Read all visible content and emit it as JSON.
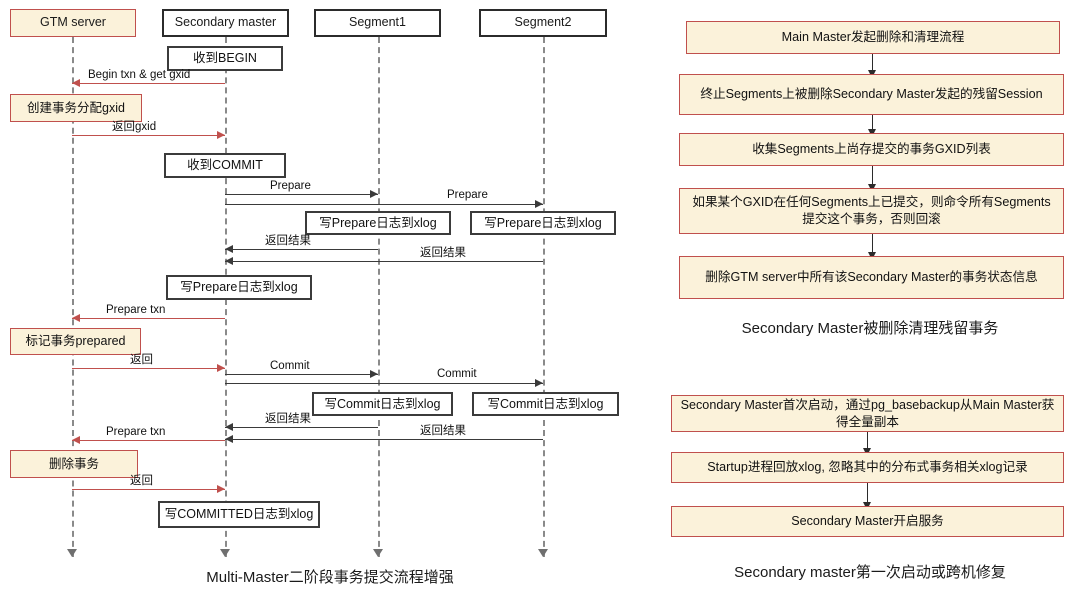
{
  "diagram": {
    "left": {
      "caption": "Multi-Master二阶段事务提交流程增强",
      "lifelines": [
        {
          "label": "GTM server",
          "accent": true
        },
        {
          "label": "Secondary master",
          "accent": false
        },
        {
          "label": "Segment1",
          "accent": false
        },
        {
          "label": "Segment2",
          "accent": false
        }
      ],
      "activities": [
        {
          "label": "收到BEGIN"
        },
        {
          "label": "收到COMMIT"
        },
        {
          "label": "写Prepare日志到xlog"
        },
        {
          "label": "写Prepare日志到xlog"
        },
        {
          "label": "写Prepare日志到xlog"
        },
        {
          "label": "写Commit日志到xlog"
        },
        {
          "label": "写Commit日志到xlog"
        },
        {
          "label": "写COMMITTED日志到xlog"
        }
      ],
      "gtm_states": [
        {
          "label": "创建事务分配gxid"
        },
        {
          "label": "标记事务prepared"
        },
        {
          "label": "删除事务"
        }
      ],
      "messages": [
        {
          "label": "Begin txn & get gxid",
          "color": "red",
          "dir": "left"
        },
        {
          "label": "返回gxid",
          "color": "red",
          "dir": "right"
        },
        {
          "label": "Prepare",
          "color": "black",
          "dir": "right"
        },
        {
          "label": "Prepare",
          "color": "black",
          "dir": "right"
        },
        {
          "label": "返回结果",
          "color": "black",
          "dir": "left"
        },
        {
          "label": "返回结果",
          "color": "black",
          "dir": "left"
        },
        {
          "label": "Prepare txn",
          "color": "red",
          "dir": "left"
        },
        {
          "label": "返回",
          "color": "red",
          "dir": "right"
        },
        {
          "label": "Commit",
          "color": "black",
          "dir": "right"
        },
        {
          "label": "Commit",
          "color": "black",
          "dir": "right"
        },
        {
          "label": "返回结果",
          "color": "black",
          "dir": "left"
        },
        {
          "label": "返回结果",
          "color": "black",
          "dir": "left"
        },
        {
          "label": "Prepare txn",
          "color": "red",
          "dir": "left"
        },
        {
          "label": "返回",
          "color": "red",
          "dir": "right"
        }
      ]
    },
    "right_top": {
      "caption": "Secondary  Master被删除清理残留事务",
      "steps": [
        {
          "label": "Main Master发起删除和清理流程"
        },
        {
          "label": "终止Segments上被删除Secondary Master发起的残留Session"
        },
        {
          "label": "收集Segments上尚存提交的事务GXID列表"
        },
        {
          "label": "如果某个GXID在任何Segments上已提交，则命令所有Segments提交这个事务，否则回滚"
        },
        {
          "label": "删除GTM server中所有该Secondary Master的事务状态信息"
        }
      ]
    },
    "right_bottom": {
      "caption": "Secondary master第一次启动或跨机修复",
      "steps": [
        {
          "label": "Secondary Master首次启动，通过pg_basebackup从Main Master获得全量副本"
        },
        {
          "label": "Startup进程回放xlog, 忽略其中的分布式事务相关xlog记录"
        },
        {
          "label": "Secondary Master开启服务"
        }
      ]
    }
  },
  "colors": {
    "accent_border": "#c0504d",
    "accent_fill": "#fbf2da",
    "box_border": "#2b2b2b",
    "lifeline": "#8a8a8a",
    "text": "#1a1a1a"
  }
}
